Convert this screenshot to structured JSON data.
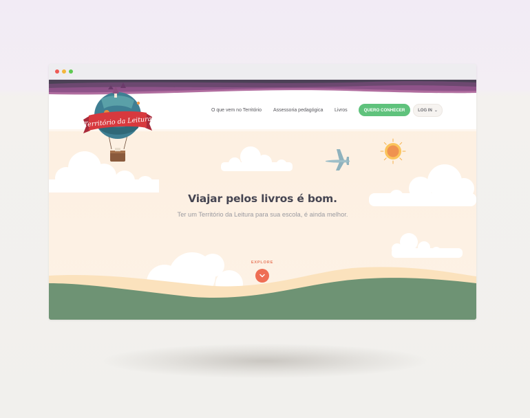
{
  "nav": {
    "items": [
      {
        "label": "O que vem no Território"
      },
      {
        "label": "Assessoria pedagógica"
      },
      {
        "label": "Livros"
      }
    ],
    "cta_label": "QUERO CONHECER",
    "login_label": "LOG IN"
  },
  "logo": {
    "text": "Território da Leitura"
  },
  "hero": {
    "title": "Viajar pelos livros é bom.",
    "subtitle": "Ter um Território da Leitura para sua escola, é ainda melhor.",
    "explore_label": "EXPLORE"
  },
  "icons": {
    "window_controls": [
      "red-dot",
      "yellow-dot",
      "green-dot"
    ],
    "decor": [
      "sun-icon",
      "airplane-icon",
      "chevron-down-icon",
      "hot-air-balloon-logo"
    ]
  },
  "colors": {
    "accent_green": "#5fc27c",
    "accent_orange": "#ee6e54",
    "hill_green": "#6e9374",
    "sand": "#fbe2bd",
    "purple_band": "#8b4f86"
  }
}
